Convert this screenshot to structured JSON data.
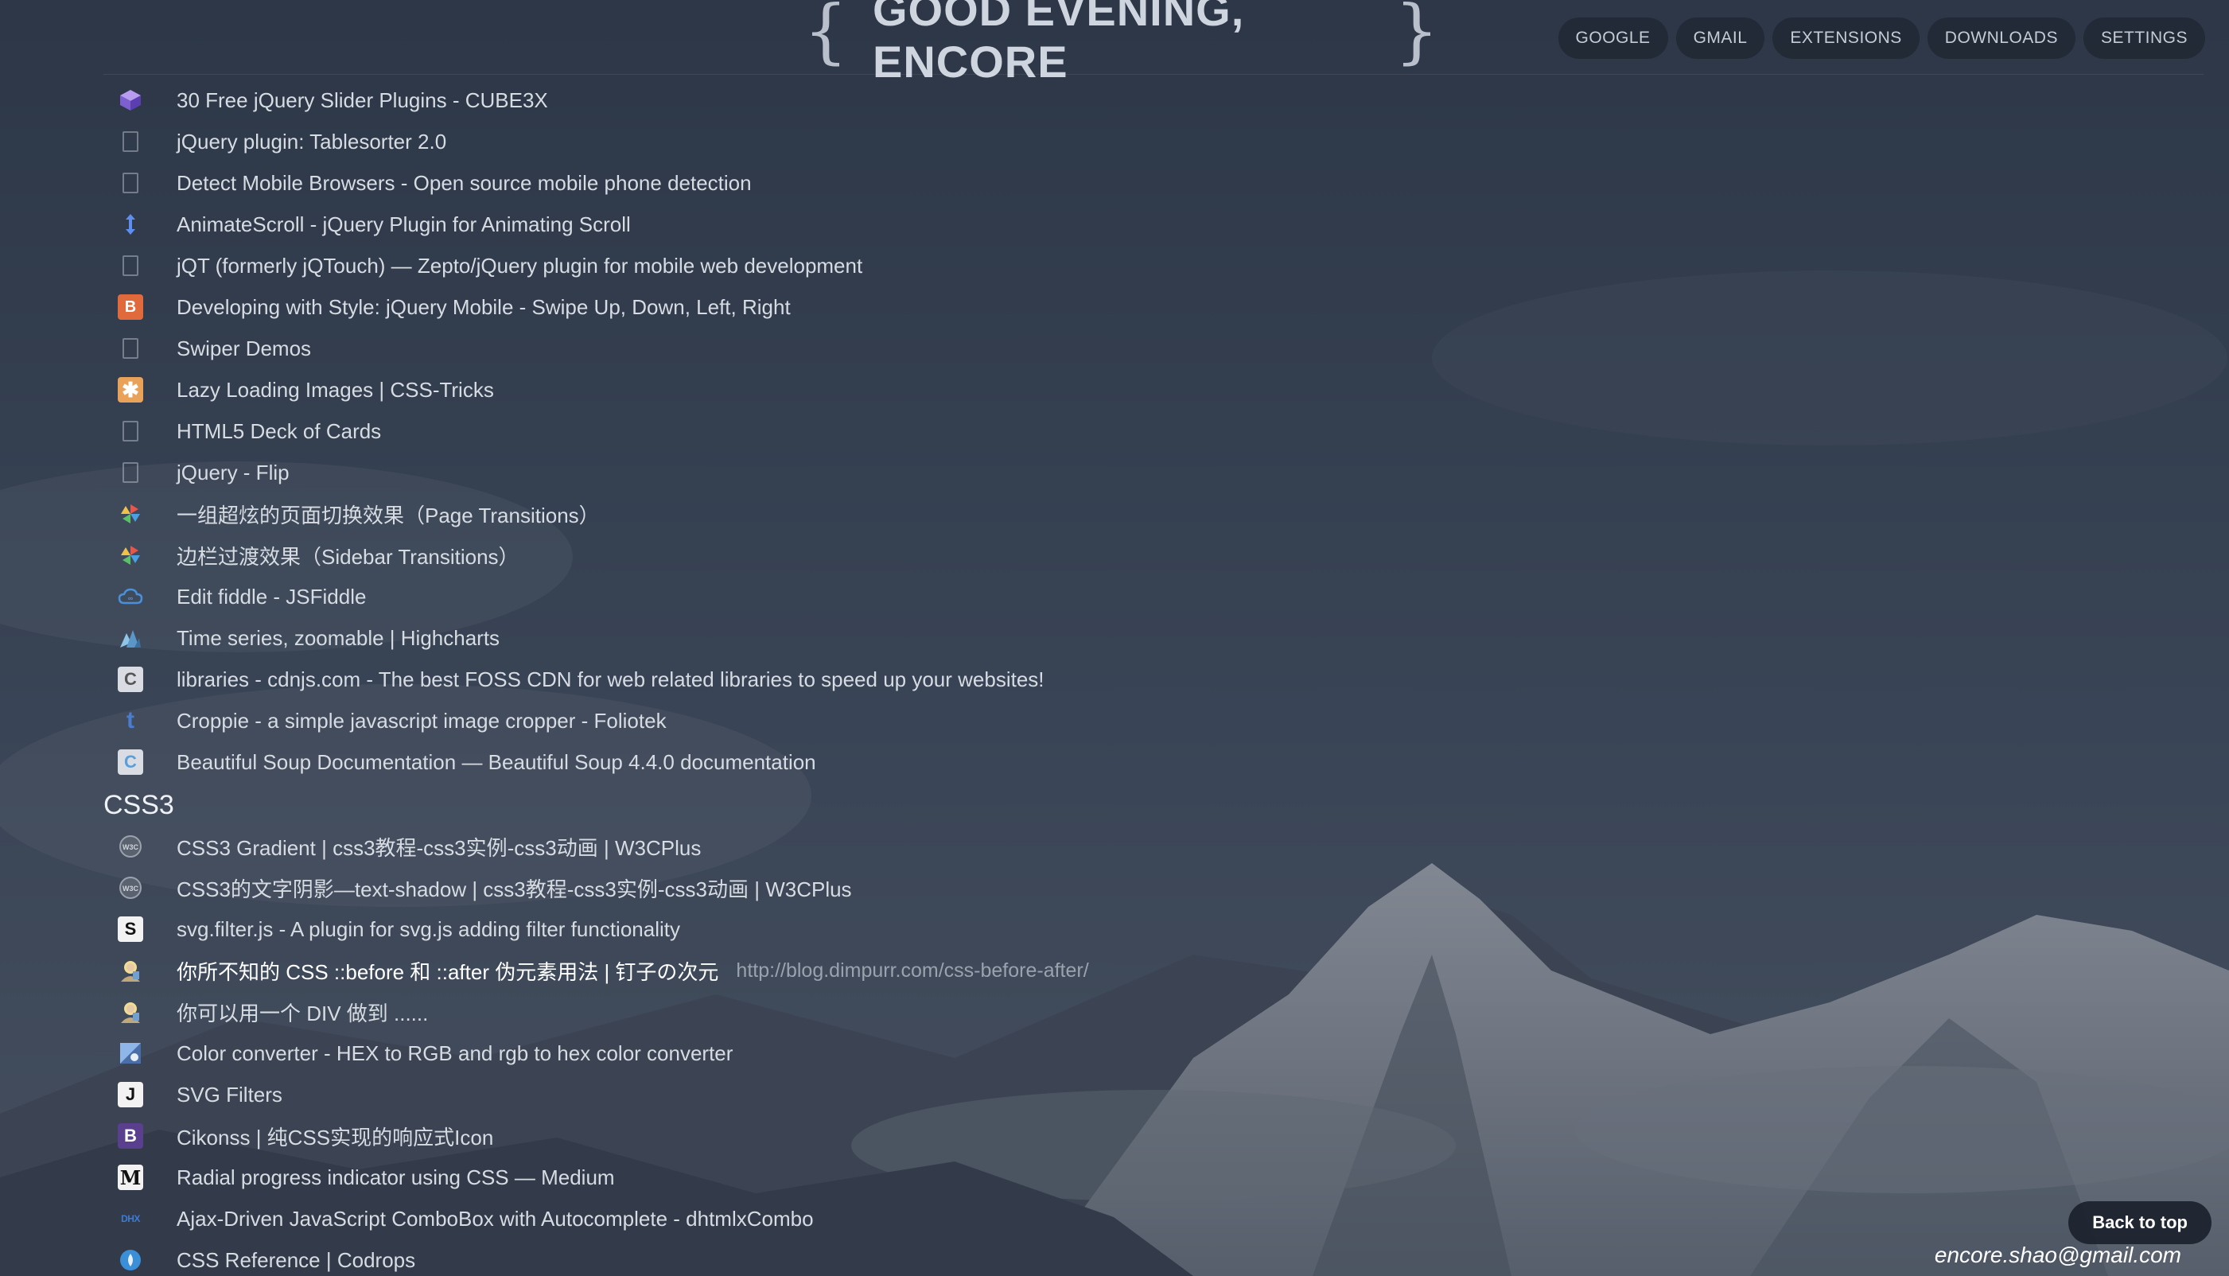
{
  "header": {
    "greeting": "GOOD EVENING, ENCORE",
    "brace_left": "{",
    "brace_right": "}",
    "nav": [
      {
        "label": "GOOGLE"
      },
      {
        "label": "GMAIL"
      },
      {
        "label": "EXTENSIONS"
      },
      {
        "label": "DOWNLOADS"
      },
      {
        "label": "SETTINGS"
      }
    ]
  },
  "bookmarks_top": [
    {
      "label": "30 Free jQuery Slider Plugins - CUBE3X",
      "icon": "cube-icon",
      "color": "#8a6bd6"
    },
    {
      "label": "jQuery plugin: Tablesorter 2.0",
      "icon": "page-icon"
    },
    {
      "label": "Detect Mobile Browsers - Open source mobile phone detection",
      "icon": "page-icon"
    },
    {
      "label": "AnimateScroll - jQuery Plugin for Animating Scroll",
      "icon": "scroll-arrows-icon",
      "color": "#5c8ff0"
    },
    {
      "label": "jQT (formerly jQTouch) — Zepto/jQuery plugin for mobile web development",
      "icon": "page-icon"
    },
    {
      "label": "Developing with Style: jQuery Mobile - Swipe Up, Down, Left, Right",
      "icon": "blogger-icon",
      "color": "#e06a3b"
    },
    {
      "label": "Swiper Demos",
      "icon": "page-icon"
    },
    {
      "label": "Lazy Loading Images | CSS-Tricks",
      "icon": "css-tricks-icon",
      "color": "#e8a25a"
    },
    {
      "label": "HTML5 Deck of Cards",
      "icon": "page-icon"
    },
    {
      "label": "jQuery - Flip",
      "icon": "page-icon"
    },
    {
      "label": "一组超炫的页面切换效果（Page Transitions）",
      "icon": "pinwheel-icon",
      "color": "#e8554a"
    },
    {
      "label": "边栏过渡效果（Sidebar Transitions）",
      "icon": "pinwheel-icon",
      "color": "#e8554a"
    },
    {
      "label": "Edit fiddle - JSFiddle",
      "icon": "cloud-icon",
      "color": "#4a90d9"
    },
    {
      "label": "Time series, zoomable | Highcharts",
      "icon": "highcharts-icon",
      "color": "#6fb0d8"
    },
    {
      "label": "libraries - cdnjs.com - The best FOSS CDN for web related libraries to speed up your websites!",
      "icon": "cdnjs-icon",
      "color": "#d9dde3"
    },
    {
      "label": "Croppie - a simple javascript image cropper - Foliotek",
      "icon": "tumblr-icon",
      "color": "#4a7dd0"
    },
    {
      "label": "Beautiful Soup Documentation — Beautiful Soup 4.4.0 documentation",
      "icon": "crummy-icon",
      "color": "#5a9fd8"
    }
  ],
  "section": {
    "title": "CSS3"
  },
  "bookmarks_css3": [
    {
      "label": "CSS3 Gradient | css3教程-css3实例-css3动画 | W3CPlus",
      "icon": "w3cplus-icon",
      "color": "#7a8290"
    },
    {
      "label": "CSS3的文字阴影—text-shadow | css3教程-css3实例-css3动画 | W3CPlus",
      "icon": "w3cplus-icon",
      "color": "#7a8290"
    },
    {
      "label": "svg.filter.js - A plugin for svg.js adding filter functionality",
      "icon": "svgjs-icon",
      "color": "#1a1a1a",
      "letter": "S"
    },
    {
      "label": "你所不知的 CSS ::before 和 ::after 伪元素用法 | 钉子の次元",
      "icon": "avatar-icon",
      "color": "#d8c070",
      "url": "http://blog.dimpurr.com/css-before-after/",
      "highlight": true
    },
    {
      "label": "你可以用一个 DIV 做到 ......",
      "icon": "avatar-icon",
      "color": "#d8c070"
    },
    {
      "label": "Color converter - HEX to RGB and rgb to hex color converter",
      "icon": "color-wheel-icon",
      "color": "#6f9ad8"
    },
    {
      "label": "SVG Filters",
      "icon": "jenkov-icon",
      "color": "#1a1a1a",
      "letter": "J"
    },
    {
      "label": "Cikonss | 纯CSS实现的响应式Icon",
      "icon": "bootstrap-icon",
      "color": "#5a3f8f",
      "letter": "B"
    },
    {
      "label": "Radial progress indicator using CSS — Medium",
      "icon": "medium-icon",
      "color": "#1a1a1a",
      "letter": "M"
    },
    {
      "label": "Ajax-Driven JavaScript ComboBox with Autocomplete - dhtmlxCombo",
      "icon": "dhtmlx-icon",
      "color": "#3a7bd5",
      "letter": "DHX"
    },
    {
      "label": "CSS Reference | Codrops",
      "icon": "codrops-icon",
      "color": "#3a8fd8"
    }
  ],
  "footer": {
    "back_to_top": "Back to top",
    "email": "encore.shao@gmail.com"
  }
}
